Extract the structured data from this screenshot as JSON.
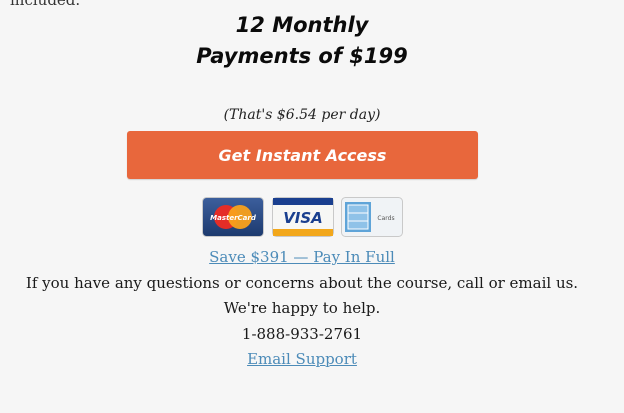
{
  "top_cut_text": "included.",
  "offer": {
    "headline_line1": "12 Monthly",
    "headline_line2": "Payments of $199",
    "per_day_note": "(That's $6.54 per day)",
    "cta_label": "Get Instant Access"
  },
  "payment_cards": [
    {
      "name": "mastercard-icon",
      "label": "MasterCard"
    },
    {
      "name": "visa-icon",
      "label": "VISA"
    },
    {
      "name": "amex-icon",
      "label": "Cards"
    }
  ],
  "pay_in_full_link": "Save $391 — Pay In Full",
  "support": {
    "questions_text": "If you have any questions or concerns about the course, call or email us.",
    "happy_text": "We're happy to help.",
    "phone": "1-888-933-2761",
    "email_link": "Email Support"
  },
  "colors": {
    "cta": "#e8673c",
    "link": "#4c8bb8",
    "background": "#f6f6f6"
  }
}
